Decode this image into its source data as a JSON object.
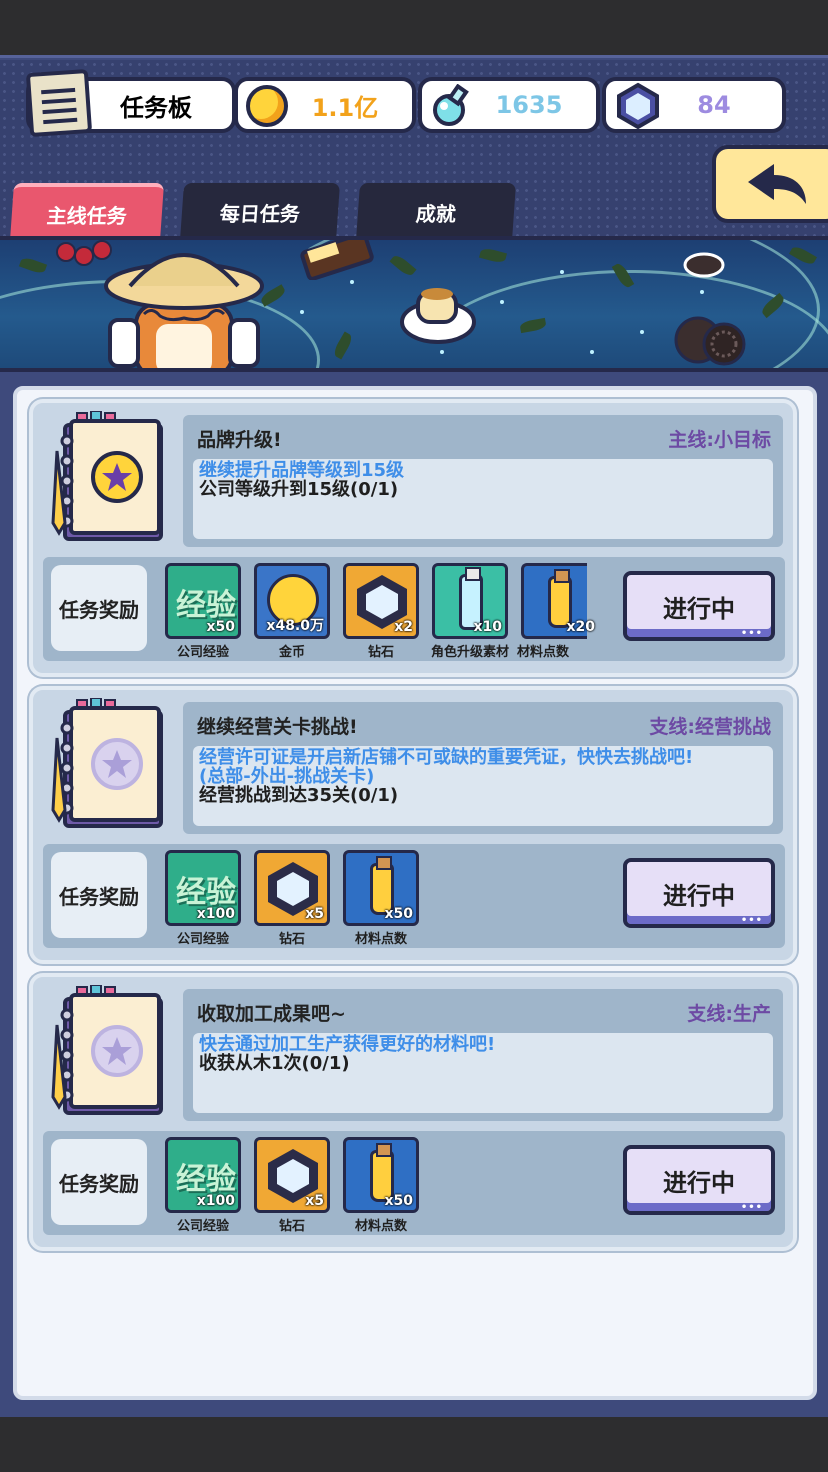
{
  "header": {
    "title": "任务板",
    "gold": "1.1亿",
    "potion": "1635",
    "gems": "84"
  },
  "tabs": [
    {
      "label": "主线任务",
      "active": true
    },
    {
      "label": "每日任务",
      "active": false
    },
    {
      "label": "成就",
      "active": false
    }
  ],
  "reward_label": "任务奖励",
  "tasks": [
    {
      "title": "品牌升级!",
      "tag": "主线:小目标",
      "goal": "继续提升品牌等级到15级",
      "hint": "",
      "progress": "公司等级升到15级(0/1)",
      "button": "进行中",
      "rewards": [
        {
          "icon": "exp-icon",
          "name": "公司经验",
          "count": "x50"
        },
        {
          "icon": "gold-coin-icon",
          "name": "金币",
          "count": "x48.0万"
        },
        {
          "icon": "diamond-icon",
          "name": "钻石",
          "count": "x2"
        },
        {
          "icon": "potion-bottle-icon",
          "name": "角色升级素材",
          "count": "x10"
        },
        {
          "icon": "material-bottle-icon",
          "name": "材料点数",
          "count": "x20"
        }
      ]
    },
    {
      "title": "继续经营关卡挑战!",
      "tag": "支线:经营挑战",
      "goal": "经营许可证是开启新店铺不可或缺的重要凭证，快快去挑战吧!",
      "hint": "(总部-外出-挑战关卡)",
      "progress": "经营挑战到达35关(0/1)",
      "button": "进行中",
      "rewards": [
        {
          "icon": "exp-icon",
          "name": "公司经验",
          "count": "x100"
        },
        {
          "icon": "diamond-icon",
          "name": "钻石",
          "count": "x5"
        },
        {
          "icon": "material-bottle-icon",
          "name": "材料点数",
          "count": "x50"
        }
      ]
    },
    {
      "title": "收取加工成果吧~",
      "tag": "支线:生产",
      "goal": "快去通过加工生产获得更好的材料吧!",
      "hint": "",
      "progress": "收获从木1次(0/1)",
      "button": "进行中",
      "rewards": [
        {
          "icon": "exp-icon",
          "name": "公司经验",
          "count": "x100"
        },
        {
          "icon": "diamond-icon",
          "name": "钻石",
          "count": "x5"
        },
        {
          "icon": "material-bottle-icon",
          "name": "材料点数",
          "count": "x50"
        }
      ]
    }
  ],
  "exp_icon_text": "经验",
  "colors": {
    "active_tab": "#e9576e",
    "tag": "#6d4aa4",
    "goal_text": "#3f8ee8"
  }
}
